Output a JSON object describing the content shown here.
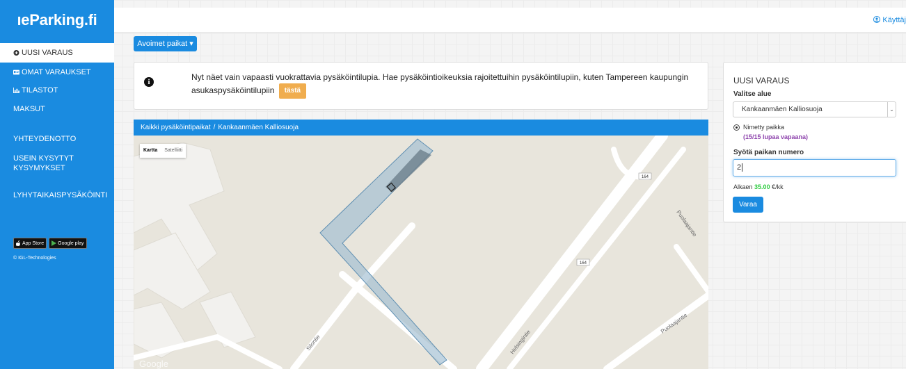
{
  "app": {
    "logo_text": "ıeParking.fi"
  },
  "sidebar": {
    "items": [
      {
        "label": "UUSI VARAUS",
        "icon": "plus-circle-icon"
      },
      {
        "label": "OMAT VARAUKSET",
        "icon": "id-card-icon"
      },
      {
        "label": "TILASTOT",
        "icon": "bar-chart-icon"
      },
      {
        "label": "MAKSUT"
      },
      {
        "label": "YHTEYDENOTTO"
      },
      {
        "label": "USEIN KYSYTYT KYSYMYKSET"
      },
      {
        "label": "LYHYTAIKAISPYSÄKÖINTI"
      }
    ],
    "badges": [
      "App Store",
      "Google play"
    ],
    "copyright": "© IGL-Technologies"
  },
  "topbar": {
    "user_label": "Käyttäj"
  },
  "toolbar": {
    "dropdown_label": "Avoimet paikat ▾"
  },
  "info": {
    "text": "Nyt näet vain vapaasti vuokrattavia pysäköintilupia. Hae pysäköintioikeuksia rajoitettuihin pysäköintilupiin, kuten Tampereen kaupungin asukaspysäköintilupiin",
    "link_label": "tästä"
  },
  "breadcrumb": {
    "root": "Kaikki pysäköintipaikat",
    "separator": "/",
    "current": "Kankaanmäen Kalliosuoja"
  },
  "map": {
    "toggle_map": "Kartta",
    "toggle_satellite": "Satelliitti",
    "road_labels": [
      "Puolaajantie",
      "Puolaajantie",
      "Helsingintie",
      "Silontie"
    ],
    "road_numbers": [
      "164",
      "164"
    ],
    "watermark": "Google"
  },
  "panel": {
    "title": "UUSI VARAUS",
    "area_label": "Valitse alue",
    "area_value": "Kankaanmäen Kalliosuoja",
    "radio_label": "Nimetty paikka",
    "availability": "(15/15 lupaa vapaana)",
    "number_label": "Syötä paikan numero",
    "number_value": "2",
    "price_prefix": "Alkaen",
    "price_value": "35.00",
    "price_suffix": "€/kk",
    "submit_label": "Varaa"
  },
  "colors": {
    "primary": "#1a8be0",
    "warning": "#f0ad4e",
    "availability": "#8e44ad",
    "price": "#2ecc40"
  }
}
